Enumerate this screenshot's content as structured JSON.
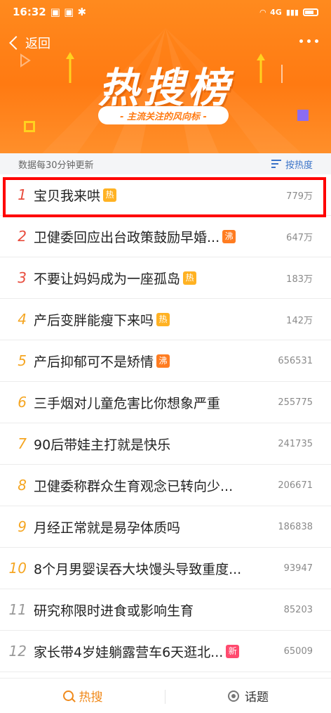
{
  "status_bar": {
    "time": "16:32",
    "network": "4G"
  },
  "header": {
    "back_label": "返回",
    "title": "热搜榜",
    "tagline": "- 主流关注的风向标 -"
  },
  "info_bar": {
    "update_text": "数据每30分钟更新",
    "sort_label": "按热度"
  },
  "list": [
    {
      "rank": "1",
      "text": "宝贝我来哄",
      "badge": "热",
      "badge_type": "hot",
      "count": "779万"
    },
    {
      "rank": "2",
      "text": "卫健委回应出台政策鼓励早婚...",
      "badge": "沸",
      "badge_type": "boil",
      "count": "647万"
    },
    {
      "rank": "3",
      "text": "不要让妈妈成为一座孤岛",
      "badge": "热",
      "badge_type": "hot",
      "count": "183万"
    },
    {
      "rank": "4",
      "text": "产后变胖能瘦下来吗",
      "badge": "热",
      "badge_type": "hot",
      "count": "142万"
    },
    {
      "rank": "5",
      "text": "产后抑郁可不是矫情",
      "badge": "沸",
      "badge_type": "boil",
      "count": "656531"
    },
    {
      "rank": "6",
      "text": "三手烟对儿童危害比你想象严重",
      "badge": "",
      "badge_type": "",
      "count": "255775"
    },
    {
      "rank": "7",
      "text": "90后带娃主打就是快乐",
      "badge": "",
      "badge_type": "",
      "count": "241735"
    },
    {
      "rank": "8",
      "text": "卫健委称群众生育观念已转向少...",
      "badge": "",
      "badge_type": "",
      "count": "206671"
    },
    {
      "rank": "9",
      "text": "月经正常就是易孕体质吗",
      "badge": "",
      "badge_type": "",
      "count": "186838"
    },
    {
      "rank": "10",
      "text": "8个月男婴误吞大块馒头导致重度...",
      "badge": "",
      "badge_type": "",
      "count": "93947"
    },
    {
      "rank": "11",
      "text": "研究称限时进食或影响生育",
      "badge": "",
      "badge_type": "",
      "count": "85203"
    },
    {
      "rank": "12",
      "text": "家长带4岁娃躺露营车6天逛北...",
      "badge": "新",
      "badge_type": "new",
      "count": "65009"
    }
  ],
  "tabs": [
    {
      "label": "热搜",
      "icon": "search-icon",
      "active": true
    },
    {
      "label": "话题",
      "icon": "topic-icon",
      "active": false
    }
  ],
  "colors": {
    "header_orange": "#ff7a12",
    "rank_top": "#e84c3d",
    "rank_other": "#f5a623",
    "highlight": "#ff0000"
  }
}
